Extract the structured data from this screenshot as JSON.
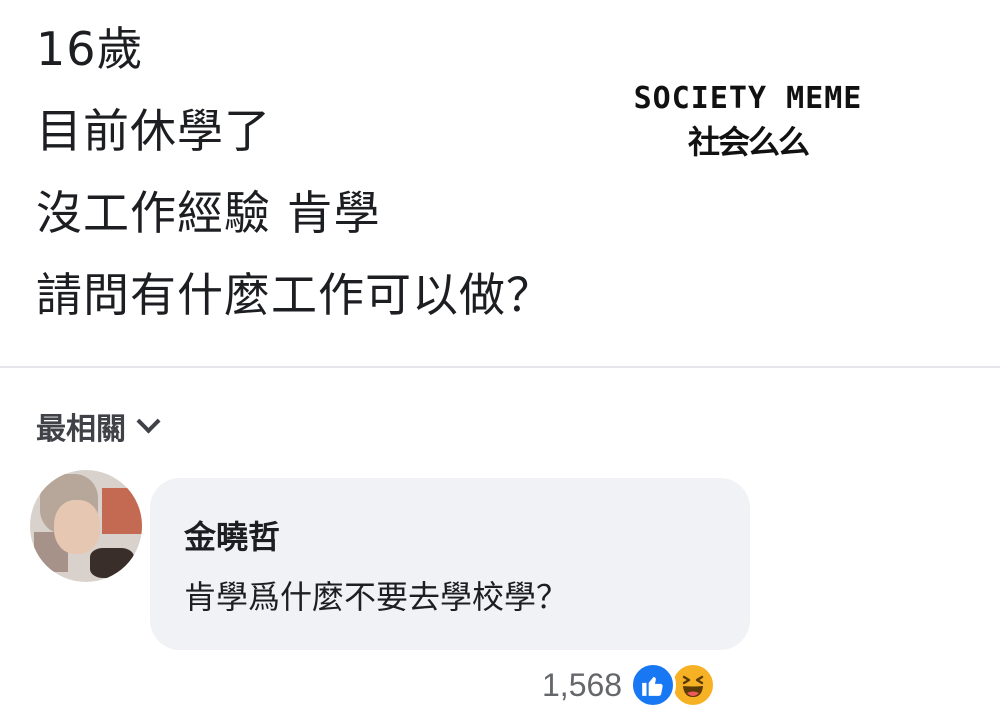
{
  "post": {
    "lines": [
      "16歲",
      "目前休學了",
      "沒工作經驗  肯學",
      "請問有什麼工作可以做？"
    ]
  },
  "watermark": {
    "english": "SOCIETY MEME",
    "chinese": "社会么么"
  },
  "comments_section": {
    "sort_label": "最相關",
    "comments": [
      {
        "author": "金曉哲",
        "text": "肯學爲什麼不要去學校學？",
        "reaction_count": "1,568",
        "reactions": [
          "like-icon",
          "haha-icon"
        ]
      }
    ]
  },
  "colors": {
    "bubble": "#f0f2f5",
    "like": "#1877f2",
    "haha": "#f7b125",
    "secondary_text": "#65676b"
  }
}
